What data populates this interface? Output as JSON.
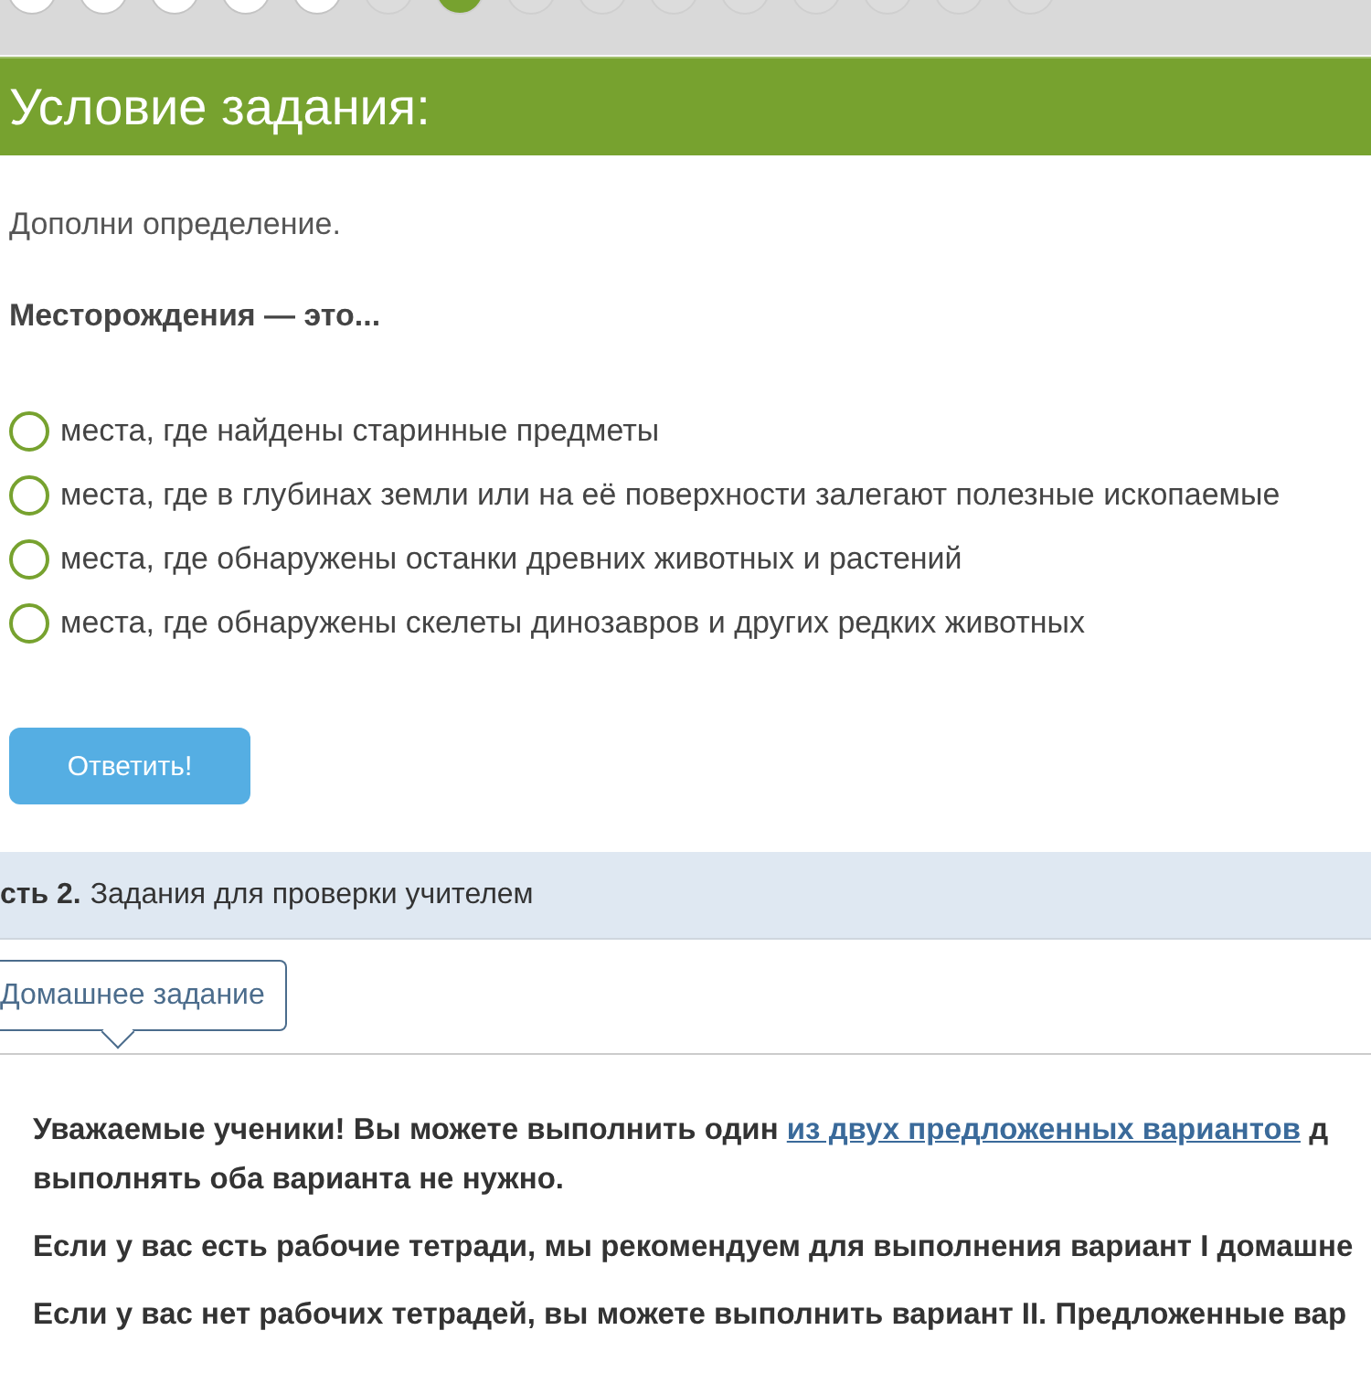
{
  "progress_steps": [
    {
      "done": true,
      "selected": false
    },
    {
      "done": true,
      "selected": false
    },
    {
      "done": true,
      "selected": false
    },
    {
      "done": true,
      "selected": false
    },
    {
      "done": true,
      "selected": false
    },
    {
      "done": false,
      "selected": false
    },
    {
      "done": false,
      "selected": true
    },
    {
      "done": false,
      "selected": false
    },
    {
      "done": false,
      "selected": false
    },
    {
      "done": false,
      "selected": false
    },
    {
      "done": false,
      "selected": false
    },
    {
      "done": false,
      "selected": false
    },
    {
      "done": false,
      "selected": false
    },
    {
      "done": false,
      "selected": false
    },
    {
      "done": false,
      "selected": false
    }
  ],
  "task": {
    "title": "Условие задания:",
    "instruction": "Дополни определение.",
    "question": "Месторождения — это...",
    "options": [
      {
        "label": "места, где найдены старинные предметы",
        "selected": false
      },
      {
        "label": "места, где в глубинах земли или на её поверхности залегают полезные ископаемые",
        "selected": false
      },
      {
        "label": "места, где обнаружены останки древних животных и растений",
        "selected": false
      },
      {
        "label": "места, где обнаружены скелеты динозавров и других редких животных",
        "selected": false
      }
    ],
    "submit_button": "Ответить!"
  },
  "section": {
    "prefix": "сть 2.",
    "title": "Задания для проверки учителем"
  },
  "tabs": [
    {
      "label": "Домашнее задание",
      "selected": true
    }
  ],
  "notice": {
    "line_1_before": "Уважаемые ученики! Вы можете выполнить один",
    "link": "из двух предложенных вариантов",
    "line_1_after": "д",
    "line_2": "выполнять оба варианта не нужно.",
    "paragraphs": [
      "Если у вас есть рабочие тетради, мы рекомендуем для выполнения вариант I домашне",
      "Если у вас нет рабочих тетрадей, вы можете выполнить вариант II. Предложенные вар"
    ]
  }
}
